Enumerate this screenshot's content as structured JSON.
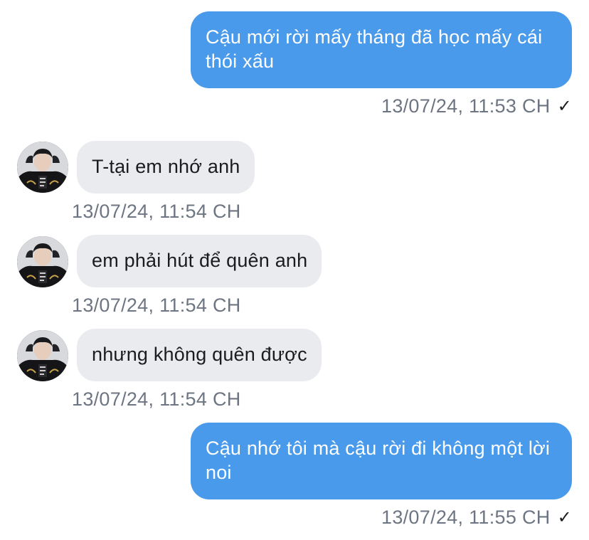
{
  "messages": [
    {
      "direction": "outgoing",
      "text": "Cậu mới rời mấy tháng đã học mấy cái thói xấu",
      "time": "13/07/24, 11:53 CH",
      "status_icon": "check-icon"
    },
    {
      "direction": "incoming",
      "text": "T-tại em nhớ anh",
      "time": "13/07/24, 11:54 CH",
      "avatar_icon": "user-avatar"
    },
    {
      "direction": "incoming",
      "text": "em phải hút để quên anh",
      "time": "13/07/24, 11:54 CH",
      "avatar_icon": "user-avatar"
    },
    {
      "direction": "incoming",
      "text": "nhưng không quên được",
      "time": "13/07/24, 11:54 CH",
      "avatar_icon": "user-avatar"
    },
    {
      "direction": "outgoing",
      "text": "Cậu nhớ tôi mà cậu rời đi không một lời noi",
      "time": "13/07/24, 11:55 CH",
      "status_icon": "check-icon"
    }
  ],
  "check_glyph": "✓",
  "colors": {
    "outgoing_bubble": "#4a9aeb",
    "incoming_bubble": "#e9ebef",
    "timestamp": "#6e7582"
  }
}
